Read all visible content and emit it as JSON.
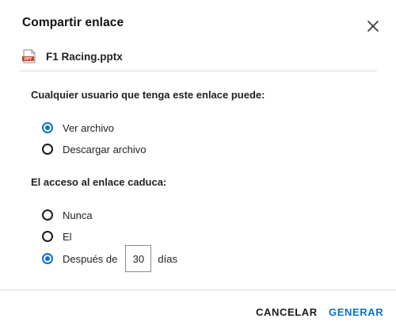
{
  "dialog": {
    "title": "Compartir enlace",
    "close_icon": "close-icon"
  },
  "file": {
    "icon": "pptx-file-icon",
    "icon_text": "PPT",
    "name": "F1 Racing.pptx"
  },
  "permissions": {
    "label": "Cualquier usuario que tenga este enlace puede:",
    "options": [
      {
        "label": "Ver archivo",
        "selected": true
      },
      {
        "label": "Descargar archivo",
        "selected": false
      }
    ]
  },
  "expiry": {
    "label": "El acceso al enlace caduca:",
    "options": [
      {
        "label": "Nunca",
        "selected": false
      },
      {
        "label": "El",
        "selected": false
      },
      {
        "label": "Después de",
        "selected": true
      }
    ],
    "days_value": "30",
    "days_suffix": "días"
  },
  "actions": {
    "cancel_label": "CANCELAR",
    "generate_label": "GENERAR"
  },
  "colors": {
    "accent": "#0a6fd6",
    "text": "#1b1b1b",
    "divider": "#dcdcdc",
    "file_icon_red": "#c8432b"
  }
}
